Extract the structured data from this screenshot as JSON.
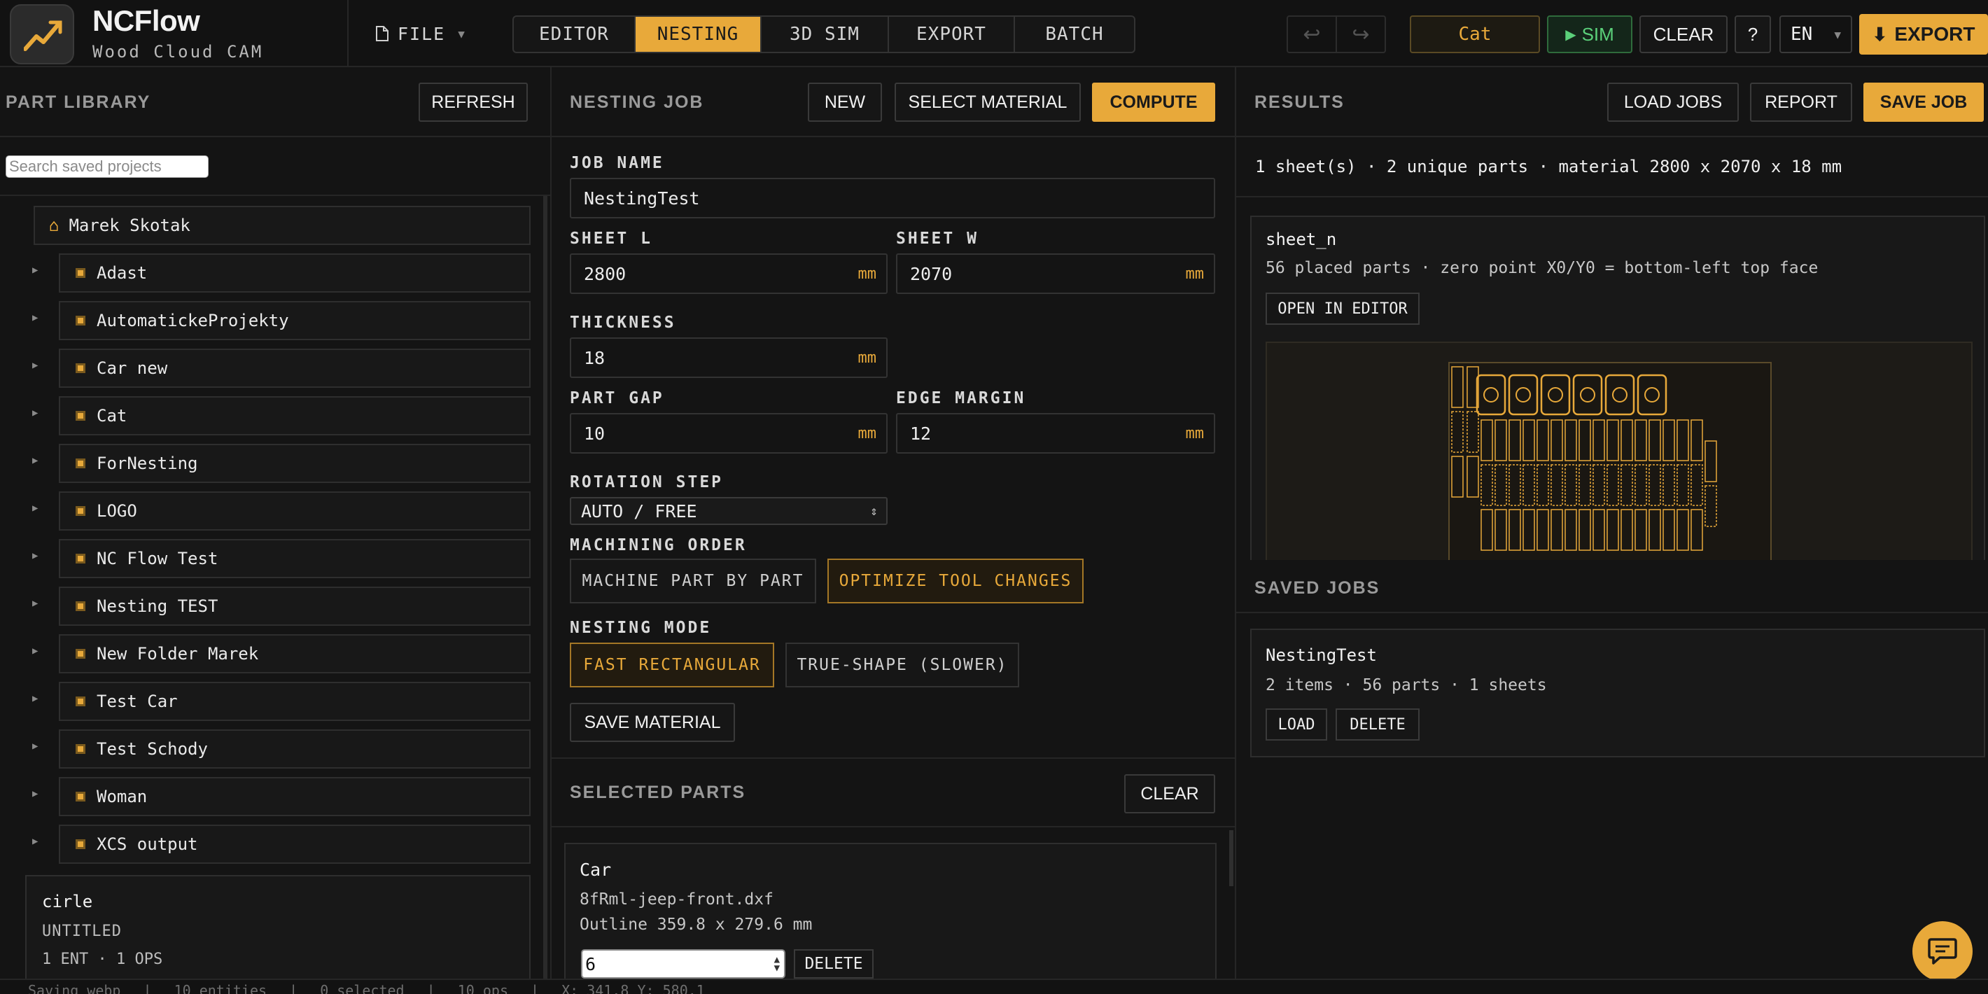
{
  "app": {
    "name": "NCFlow",
    "subtitle": "Wood Cloud CAM",
    "file_menu": "FILE",
    "tabs": [
      {
        "label": "EDITOR",
        "active": false
      },
      {
        "label": "NESTING",
        "active": true
      },
      {
        "label": "3D SIM",
        "active": false
      },
      {
        "label": "EXPORT",
        "active": false
      },
      {
        "label": "BATCH",
        "active": false
      }
    ],
    "undo_icon": "undo-icon",
    "redo_icon": "redo-icon",
    "current_project": "Cat",
    "sim_label": "SIM",
    "clear_label": "CLEAR",
    "help_label": "?",
    "language": "EN",
    "export_label": "EXPORT",
    "accent_color": "#e8a93a",
    "sim_color": "#5bd07a"
  },
  "library": {
    "title": "PART LIBRARY",
    "refresh_label": "REFRESH",
    "search_placeholder": "Search saved projects",
    "root": "Marek Skotak",
    "folders": [
      "Adast",
      "AutomatickeProjekty",
      "Car new",
      "Cat",
      "ForNesting",
      "LOGO",
      "NC Flow Test",
      "Nesting TEST",
      "New Folder Marek",
      "Test Car",
      "Test Schody",
      "Woman",
      "XCS output"
    ],
    "project_card": {
      "name": "cirle",
      "status": "UNTITLED",
      "meta": "1 ENT · 1 OPS"
    }
  },
  "job": {
    "title": "NESTING JOB",
    "new_label": "NEW",
    "select_material_label": "SELECT MATERIAL",
    "compute_label": "COMPUTE",
    "job_name_label": "JOB NAME",
    "job_name": "NestingTest",
    "sheet_l_label": "SHEET L",
    "sheet_l": "2800",
    "sheet_w_label": "SHEET W",
    "sheet_w": "2070",
    "thickness_label": "THICKNESS",
    "thickness": "18",
    "part_gap_label": "PART GAP",
    "part_gap": "10",
    "edge_margin_label": "EDGE MARGIN",
    "edge_margin": "12",
    "unit": "mm",
    "rotation_label": "ROTATION STEP",
    "rotation_value": "AUTO / FREE",
    "machining_label": "MACHINING ORDER",
    "machining_options": [
      "MACHINE PART BY PART",
      "OPTIMIZE TOOL CHANGES"
    ],
    "machining_selected": 1,
    "nesting_mode_label": "NESTING MODE",
    "nesting_options": [
      "FAST RECTANGULAR",
      "TRUE-SHAPE (SLOWER)"
    ],
    "nesting_selected": 0,
    "save_material_label": "SAVE MATERIAL"
  },
  "selected_parts": {
    "title": "SELECTED PARTS",
    "clear_label": "CLEAR",
    "items": [
      {
        "name": "Car",
        "file": "8fRml-jeep-front.dxf",
        "outline": "Outline 359.8 x 279.6 mm",
        "quantity": "6",
        "delete_label": "DELETE"
      }
    ]
  },
  "results": {
    "title": "RESULTS",
    "load_jobs_label": "LOAD JOBS",
    "report_label": "REPORT",
    "save_job_label": "SAVE JOB",
    "summary": "1 sheet(s) · 2 unique parts · material 2800 x 2070 x 18 mm",
    "sheet": {
      "name": "sheet_n",
      "info": "56 placed parts · zero point X0/Y0 = bottom-left top face",
      "open_label": "OPEN IN EDITOR",
      "placed_parts": 56
    }
  },
  "saved_jobs": {
    "title": "SAVED JOBS",
    "items": [
      {
        "name": "NestingTest",
        "meta": "2 items · 56 parts · 1 sheets",
        "load_label": "LOAD",
        "delete_label": "DELETE"
      }
    ]
  },
  "status_bar": {
    "items": [
      "Saving webp",
      "10 entities",
      "0 selected",
      "10 ops",
      "X: 341.8 Y: 580.1"
    ]
  },
  "chat_icon": "chat-bubble-icon"
}
